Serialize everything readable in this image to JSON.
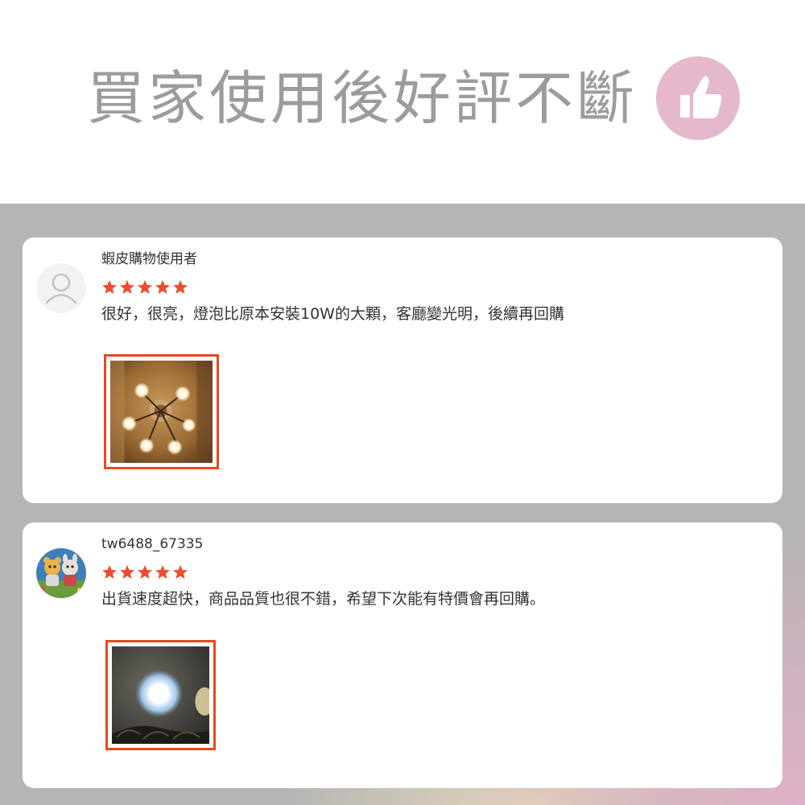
{
  "header": {
    "headline": "買家使用後好評不斷",
    "badge_icon": "thumbs-up-icon"
  },
  "colors": {
    "star": "#ee4d2d",
    "photo_border": "#e8481f",
    "badge": "#e6b8cc",
    "headline": "#9c9c9c"
  },
  "reviews": [
    {
      "username": "蝦皮購物使用者",
      "avatar": "default-user-icon",
      "rating": 5,
      "text": "很好，很亮，燈泡比原本安裝10W的大顆，客廳變光明，後續再回購",
      "photo": "chandelier-photo"
    },
    {
      "username": "tw6488_67335",
      "avatar": "cartoon-bears-avatar",
      "rating": 5,
      "text": "出貨速度超快，商品品質也很不錯，希望下次能有特價會再回購。",
      "photo": "bulb-closeup-photo"
    }
  ]
}
